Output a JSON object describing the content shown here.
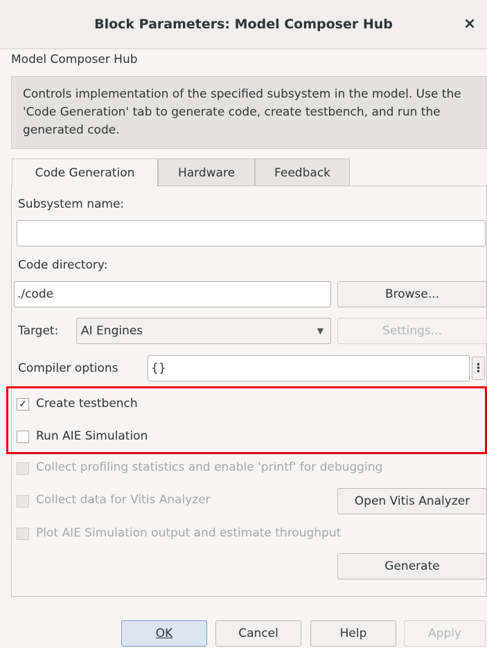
{
  "window": {
    "title": "Block Parameters: Model Composer Hub",
    "close_glyph": "×"
  },
  "block": {
    "name": "Model Composer Hub",
    "description": "Controls implementation of the specified subsystem in the model. Use the 'Code Generation' tab to generate code, create testbench, and run the generated code."
  },
  "tabs": [
    {
      "label": "Code Generation",
      "active": true
    },
    {
      "label": "Hardware",
      "active": false
    },
    {
      "label": "Feedback",
      "active": false
    }
  ],
  "code_generation": {
    "subsystem_label": "Subsystem name:",
    "subsystem_value": "",
    "code_dir_label": "Code directory:",
    "code_dir_value": "./code",
    "browse_label": "Browse...",
    "target_label": "Target:",
    "target_value": "AI Engines",
    "settings_label": "Settings...",
    "compiler_label": "Compiler options",
    "compiler_value": "{}",
    "more_glyph": "⋮",
    "create_testbench": {
      "label": "Create testbench",
      "checked": true
    },
    "run_aie_sim": {
      "label": "Run AIE Simulation",
      "checked": false
    },
    "collect_profiling": {
      "label": "Collect profiling statistics and enable 'printf' for debugging",
      "checked": false,
      "enabled": false
    },
    "collect_vitis": {
      "label": "Collect data for Vitis Analyzer",
      "checked": false,
      "enabled": false
    },
    "open_vitis_label": "Open Vitis Analyzer",
    "plot_aie": {
      "label": "Plot AIE Simulation output and estimate throughput",
      "checked": false,
      "enabled": false
    },
    "generate_label": "Generate"
  },
  "footer": {
    "ok_label": "OK",
    "cancel_label": "Cancel",
    "help_label": "Help",
    "apply_label": "Apply"
  },
  "colors": {
    "highlight": "#e60012"
  }
}
